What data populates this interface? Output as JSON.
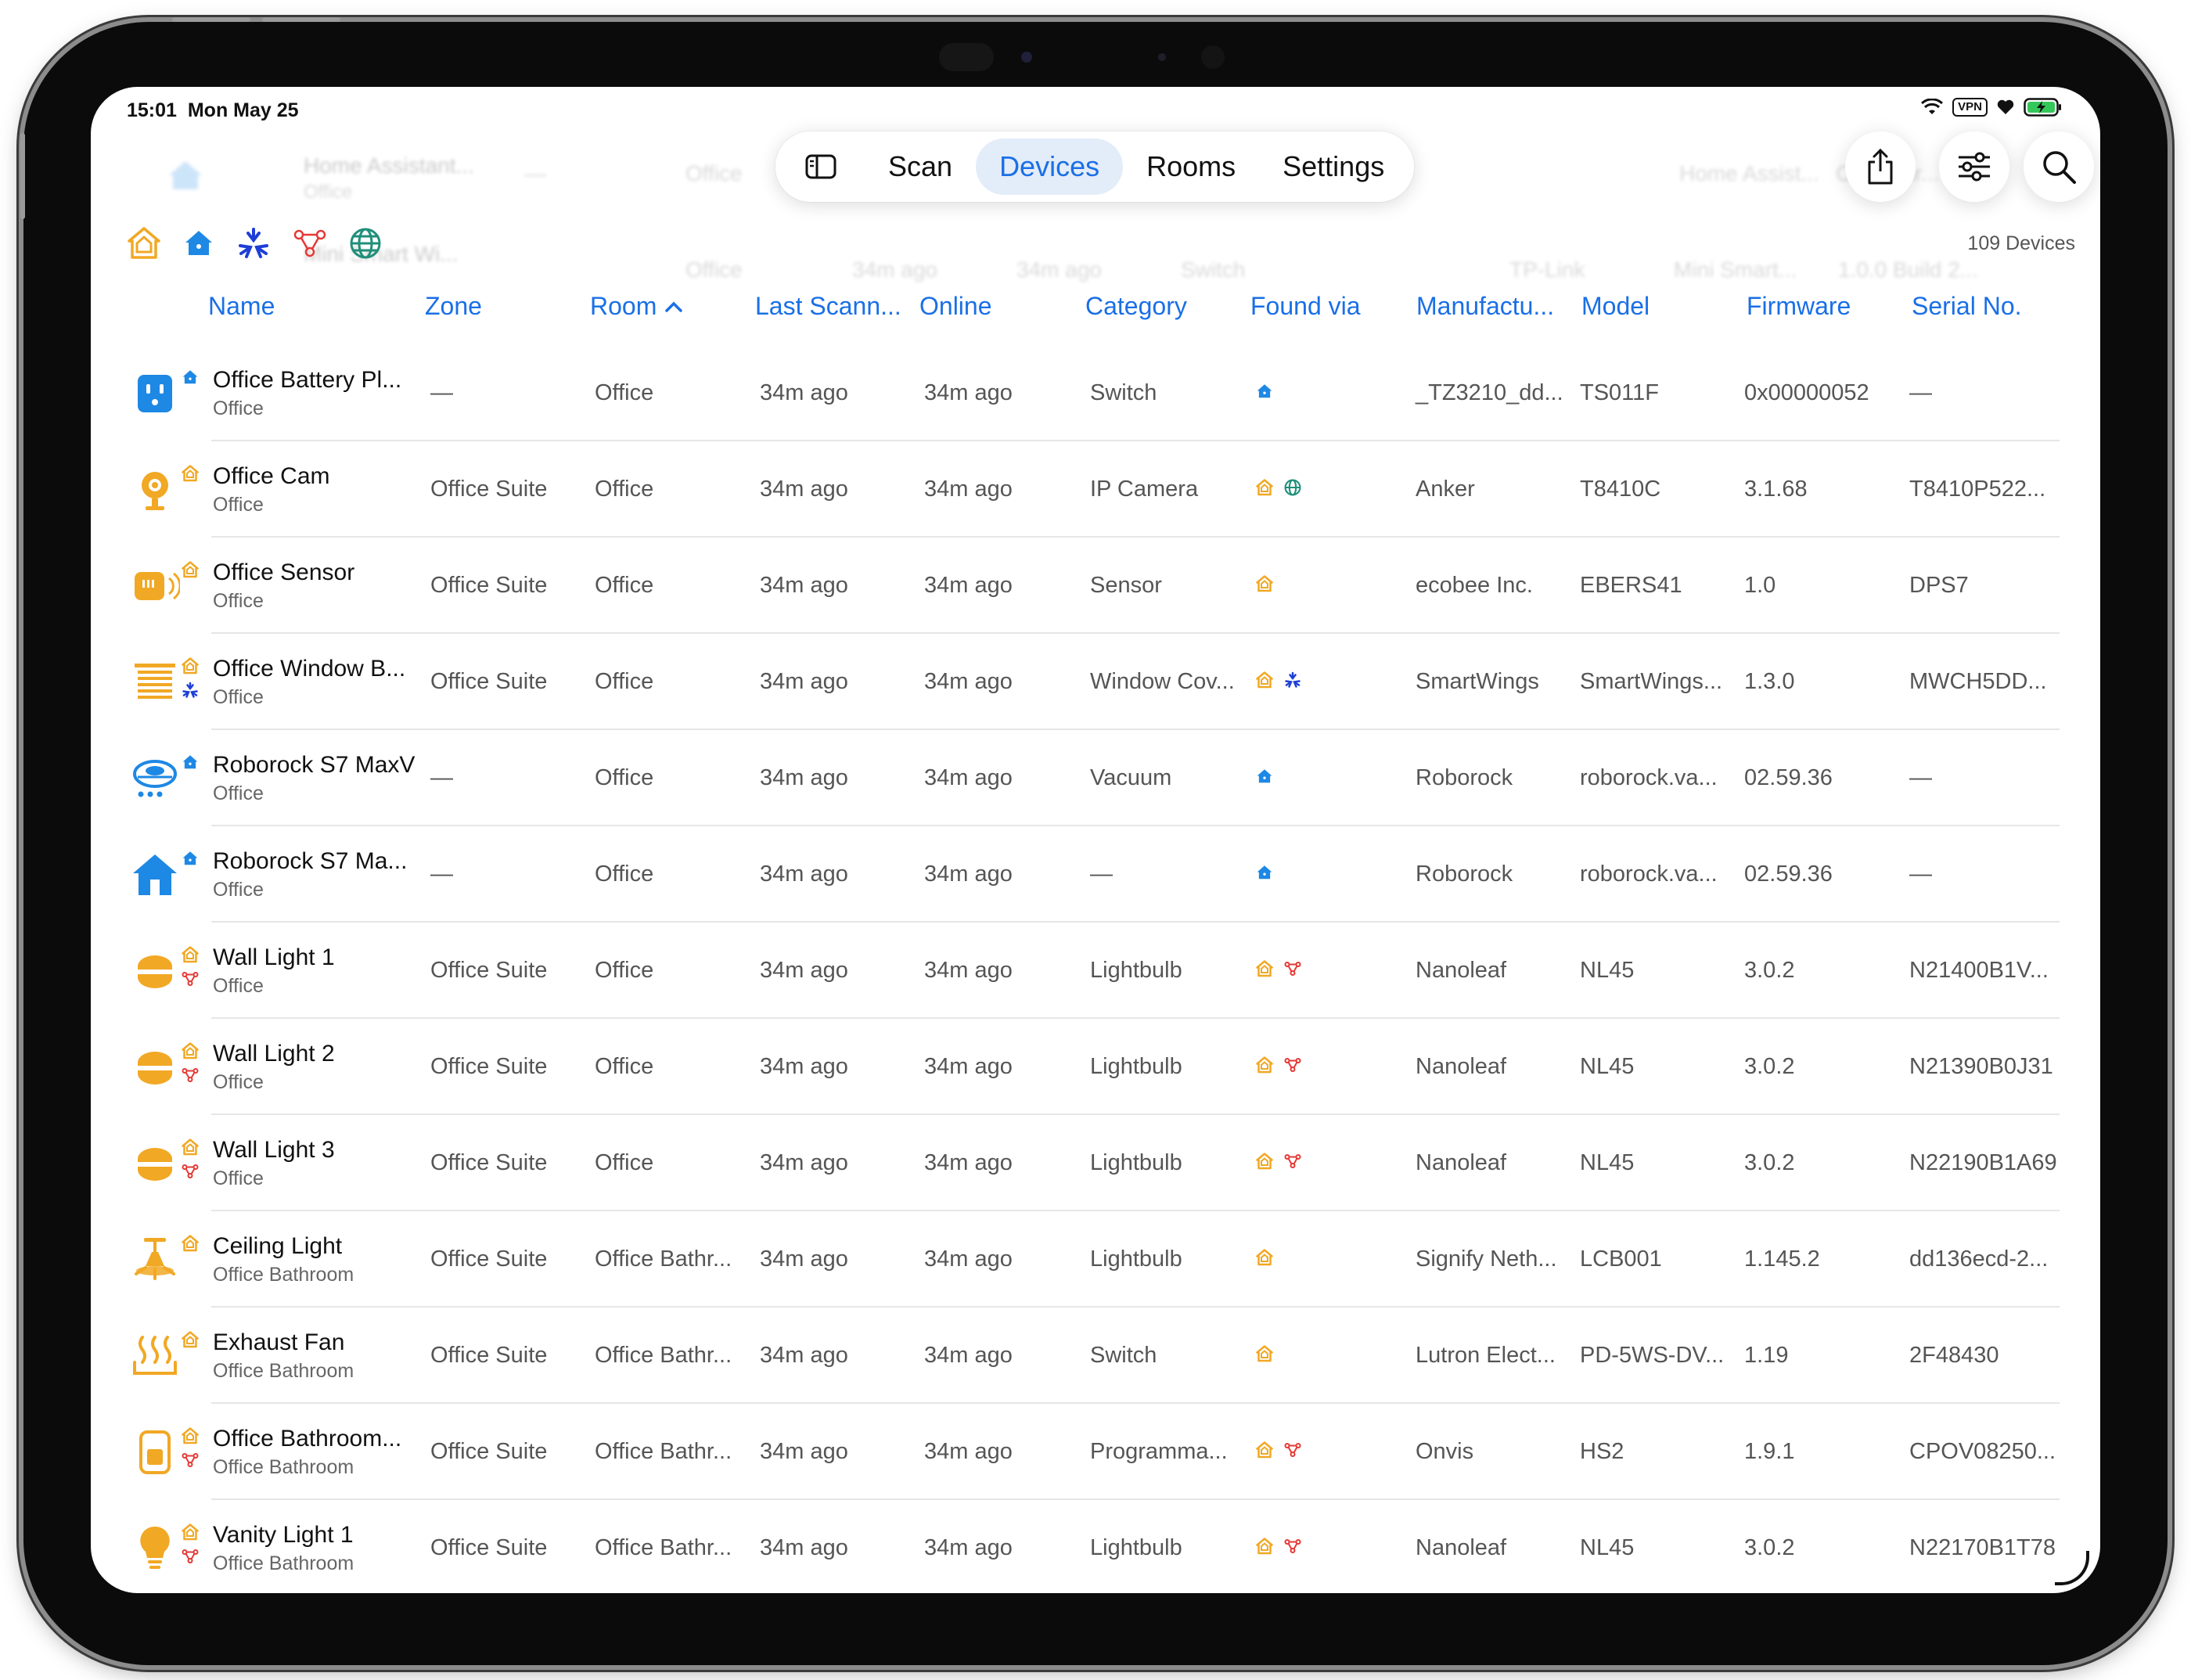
{
  "status_bar": {
    "time": "15:01",
    "date": "Mon May 25",
    "vpn": "VPN"
  },
  "nav": {
    "tabs": [
      "Scan",
      "Devices",
      "Rooms",
      "Settings"
    ],
    "active": "Devices"
  },
  "device_count": "109 Devices",
  "sort": {
    "column": "Room",
    "direction": "ascending"
  },
  "colors": {
    "accent": "#1a6fe6",
    "homekit": "#f1a824",
    "home_assistant": "#1e88e5",
    "matter": "#1d3fd6",
    "nanoleaf": "#e53935",
    "web": "#1f8f7a"
  },
  "columns": [
    "Name",
    "Zone",
    "Room",
    "Last Scann...",
    "Online",
    "Category",
    "Found via",
    "Manufactu...",
    "Model",
    "Firmware",
    "Serial No."
  ],
  "ghost_rows": [
    {
      "name": "Home Assistant...",
      "room": "Office",
      "zone": "—",
      "manufacturer": "Home Assist...",
      "model": "OpenThr..."
    },
    {
      "name": "Mini Smart Wi...",
      "room": "Office",
      "last_scan": "34m ago",
      "online": "34m ago",
      "category": "Switch",
      "manufacturer": "TP-Link",
      "model": "Mini Smart...",
      "firmware": "1.0.0 Build 2..."
    }
  ],
  "rows": [
    {
      "name": "Office Battery Pl...",
      "room_sub": "Office",
      "zone": "—",
      "room": "Office",
      "last_scan": "34m ago",
      "online": "34m ago",
      "category": "Switch",
      "manufacturer": "_TZ3210_dd...",
      "model": "TS011F",
      "firmware": "0x00000052",
      "serial": "—",
      "icon": "outlet-icon",
      "sources": [
        "home-assistant"
      ]
    },
    {
      "name": "Office Cam",
      "room_sub": "Office",
      "zone": "Office Suite",
      "room": "Office",
      "last_scan": "34m ago",
      "online": "34m ago",
      "category": "IP Camera",
      "manufacturer": "Anker",
      "model": "T8410C",
      "firmware": "3.1.68",
      "serial": "T8410P522...",
      "icon": "camera-icon",
      "sources": [
        "homekit",
        "web"
      ]
    },
    {
      "name": "Office Sensor",
      "room_sub": "Office",
      "zone": "Office Suite",
      "room": "Office",
      "last_scan": "34m ago",
      "online": "34m ago",
      "category": "Sensor",
      "manufacturer": "ecobee Inc.",
      "model": "EBERS41",
      "firmware": "1.0",
      "serial": "DPS7",
      "icon": "sensor-icon",
      "sources": [
        "homekit"
      ]
    },
    {
      "name": "Office Window B...",
      "room_sub": "Office",
      "zone": "Office Suite",
      "room": "Office",
      "last_scan": "34m ago",
      "online": "34m ago",
      "category": "Window Cov...",
      "manufacturer": "SmartWings",
      "model": "SmartWings...",
      "firmware": "1.3.0",
      "serial": "MWCH5DD...",
      "icon": "blinds-icon",
      "sources": [
        "homekit",
        "matter"
      ]
    },
    {
      "name": "Roborock S7 MaxV",
      "room_sub": "Office",
      "zone": "—",
      "room": "Office",
      "last_scan": "34m ago",
      "online": "34m ago",
      "category": "Vacuum",
      "manufacturer": "Roborock",
      "model": "roborock.va...",
      "firmware": "02.59.36",
      "serial": "—",
      "icon": "vacuum-icon",
      "sources": [
        "home-assistant"
      ]
    },
    {
      "name": "Roborock S7 Ma...",
      "room_sub": "Office",
      "zone": "—",
      "room": "Office",
      "last_scan": "34m ago",
      "online": "34m ago",
      "category": "—",
      "manufacturer": "Roborock",
      "model": "roborock.va...",
      "firmware": "02.59.36",
      "serial": "—",
      "icon": "house-icon",
      "sources": [
        "home-assistant"
      ]
    },
    {
      "name": "Wall Light 1",
      "room_sub": "Office",
      "zone": "Office Suite",
      "room": "Office",
      "last_scan": "34m ago",
      "online": "34m ago",
      "category": "Lightbulb",
      "manufacturer": "Nanoleaf",
      "model": "NL45",
      "firmware": "3.0.2",
      "serial": "N21400B1V...",
      "icon": "wall-light-icon",
      "sources": [
        "homekit",
        "nanoleaf"
      ]
    },
    {
      "name": "Wall Light 2",
      "room_sub": "Office",
      "zone": "Office Suite",
      "room": "Office",
      "last_scan": "34m ago",
      "online": "34m ago",
      "category": "Lightbulb",
      "manufacturer": "Nanoleaf",
      "model": "NL45",
      "firmware": "3.0.2",
      "serial": "N21390B0J31",
      "icon": "wall-light-icon",
      "sources": [
        "homekit",
        "nanoleaf"
      ]
    },
    {
      "name": "Wall Light 3",
      "room_sub": "Office",
      "zone": "Office Suite",
      "room": "Office",
      "last_scan": "34m ago",
      "online": "34m ago",
      "category": "Lightbulb",
      "manufacturer": "Nanoleaf",
      "model": "NL45",
      "firmware": "3.0.2",
      "serial": "N22190B1A69",
      "icon": "wall-light-icon",
      "sources": [
        "homekit",
        "nanoleaf"
      ]
    },
    {
      "name": "Ceiling Light",
      "room_sub": "Office Bathroom",
      "zone": "Office Suite",
      "room": "Office Bathr...",
      "last_scan": "34m ago",
      "online": "34m ago",
      "category": "Lightbulb",
      "manufacturer": "Signify Neth...",
      "model": "LCB001",
      "firmware": "1.145.2",
      "serial": "dd136ecd-2...",
      "icon": "ceiling-light-icon",
      "sources": [
        "homekit"
      ]
    },
    {
      "name": "Exhaust Fan",
      "room_sub": "Office Bathroom",
      "zone": "Office Suite",
      "room": "Office Bathr...",
      "last_scan": "34m ago",
      "online": "34m ago",
      "category": "Switch",
      "manufacturer": "Lutron Elect...",
      "model": "PD-5WS-DV...",
      "firmware": "1.19",
      "serial": "2F48430",
      "icon": "heat-icon",
      "sources": [
        "homekit"
      ]
    },
    {
      "name": "Office Bathroom...",
      "room_sub": "Office Bathroom",
      "zone": "Office Suite",
      "room": "Office Bathr...",
      "last_scan": "34m ago",
      "online": "34m ago",
      "category": "Programma...",
      "manufacturer": "Onvis",
      "model": "HS2",
      "firmware": "1.9.1",
      "serial": "CPOV08250...",
      "icon": "switch-icon",
      "sources": [
        "homekit",
        "nanoleaf"
      ]
    },
    {
      "name": "Vanity Light 1",
      "room_sub": "Office Bathroom",
      "zone": "Office Suite",
      "room": "Office Bathr...",
      "last_scan": "34m ago",
      "online": "34m ago",
      "category": "Lightbulb",
      "manufacturer": "Nanoleaf",
      "model": "NL45",
      "firmware": "3.0.2",
      "serial": "N22170B1T78",
      "icon": "bulb-icon",
      "sources": [
        "homekit",
        "nanoleaf"
      ]
    }
  ]
}
